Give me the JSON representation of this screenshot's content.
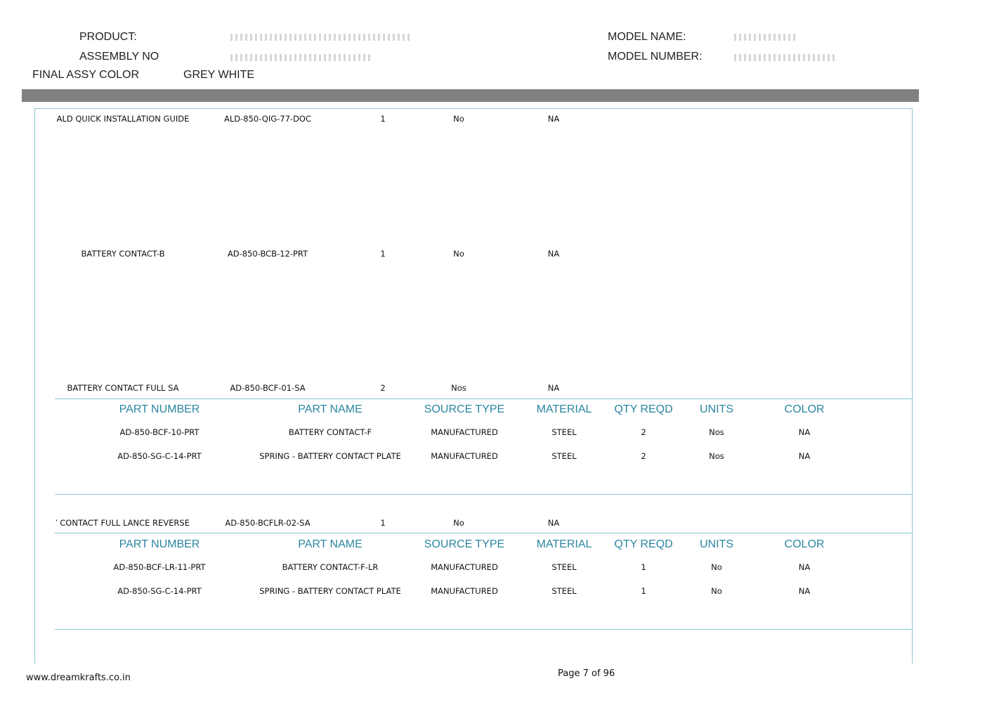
{
  "header": {
    "product_label": "PRODUCT:",
    "assembly_label": "ASSEMBLY NO",
    "color_label": "FINAL ASSY COLOR",
    "color_value": "GREY WHITE",
    "model_name_label": "MODEL NAME:",
    "model_number_label": "MODEL NUMBER:"
  },
  "items": [
    {
      "name": "ALD QUICK INSTALLATION GUIDE",
      "part": "ALD-850-QIG-77-DOC",
      "qty": "1",
      "units": "No",
      "color": "NA"
    },
    {
      "name": "BATTERY CONTACT-B",
      "part": "AD-850-BCB-12-PRT",
      "qty": "1",
      "units": "No",
      "color": "NA"
    },
    {
      "name": "BATTERY CONTACT FULL SA",
      "part": "AD-850-BCF-01-SA",
      "qty": "2",
      "units": "Nos",
      "color": "NA"
    },
    {
      "name": "BATTERY CONTACT FULL LANCE REVERSE",
      "part": "AD-850-BCFLR-02-SA",
      "qty": "1",
      "units": "No",
      "color": "NA"
    }
  ],
  "sub_headers": [
    "PART NUMBER",
    "PART NAME",
    "SOURCE TYPE",
    "MATERIAL",
    "QTY REQD",
    "UNITS",
    "COLOR"
  ],
  "sub_tables": [
    {
      "rows": [
        [
          "AD-850-BCF-10-PRT",
          "BATTERY CONTACT-F",
          "MANUFACTURED",
          "STEEL",
          "2",
          "Nos",
          "NA"
        ],
        [
          "AD-850-SG-C-14-PRT",
          "SPRING - BATTERY CONTACT PLATE",
          "MANUFACTURED",
          "STEEL",
          "2",
          "Nos",
          "NA"
        ]
      ]
    },
    {
      "rows": [
        [
          "AD-850-BCF-LR-11-PRT",
          "BATTERY CONTACT-F-LR",
          "MANUFACTURED",
          "STEEL",
          "1",
          "No",
          "NA"
        ],
        [
          "AD-850-SG-C-14-PRT",
          "SPRING - BATTERY CONTACT PLATE",
          "MANUFACTURED",
          "STEEL",
          "1",
          "No",
          "NA"
        ]
      ]
    }
  ],
  "footer": {
    "website": "www.dreamkrafts.co.in",
    "page": "Page 7 of 96"
  }
}
